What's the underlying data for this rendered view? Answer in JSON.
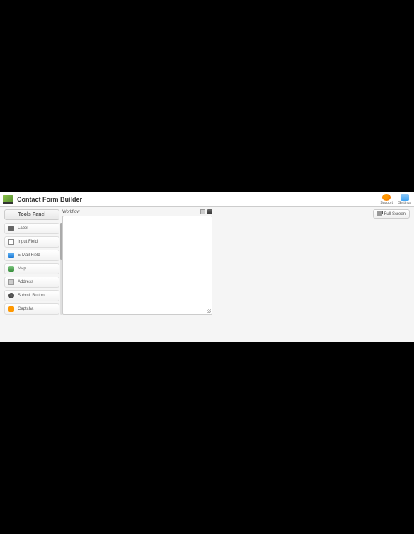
{
  "header": {
    "title": "Contact Form Builder",
    "support_label": "Support",
    "settings_label": "Settings"
  },
  "sidebar": {
    "title": "Tools Panel",
    "items": [
      {
        "label": "Label",
        "icon": "label"
      },
      {
        "label": "Input Field",
        "icon": "input"
      },
      {
        "label": "E-Mail Field",
        "icon": "email"
      },
      {
        "label": "Map",
        "icon": "map"
      },
      {
        "label": "Address",
        "icon": "address"
      },
      {
        "label": "Submit Button",
        "icon": "submit"
      },
      {
        "label": "Captcha",
        "icon": "captcha"
      }
    ]
  },
  "workflow": {
    "title": "Workflow"
  },
  "fullscreen": {
    "label": "Full Screen"
  }
}
